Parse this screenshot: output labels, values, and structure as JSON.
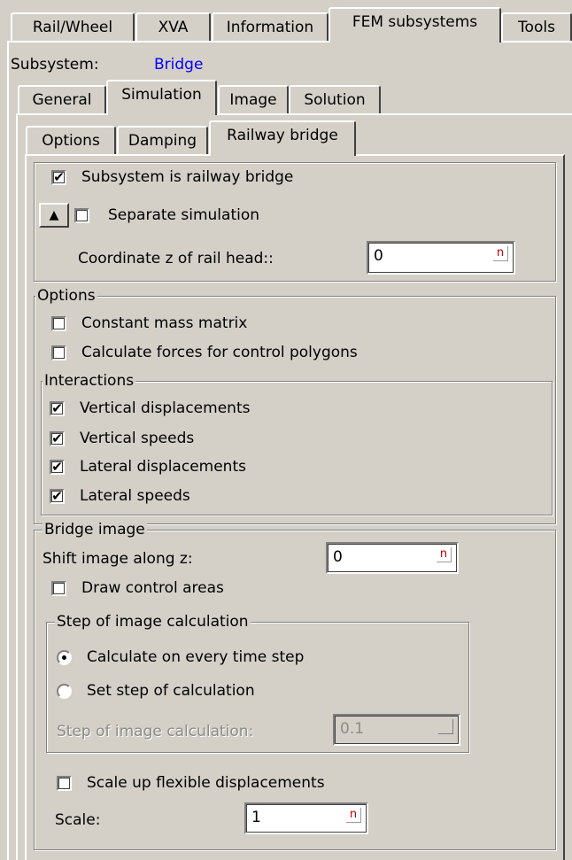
{
  "top_tabs": [
    "Rail/Wheel",
    "XVA",
    "Information",
    "FEM subsystems",
    "Tools"
  ],
  "active_top_tab": "FEM subsystems",
  "subsystem": {
    "label": "Subsystem:",
    "value": "Bridge",
    "value_color": "#0000ff"
  },
  "sub_tabs": [
    "General",
    "Simulation",
    "Image",
    "Solution"
  ],
  "active_sub_tab": "Simulation",
  "inner_tabs": [
    "Options",
    "Damping",
    "Railway bridge"
  ],
  "active_inner_tab": "Railway bridge",
  "railway": {
    "is_railway_bridge": {
      "label": "Subsystem is railway bridge",
      "checked": true
    },
    "separate_simulation": {
      "label": "Separate simulation",
      "checked": false
    },
    "up_icon": "triangle-up-icon",
    "rail_head": {
      "label": "Coordinate z of rail head::",
      "value": "0",
      "unit_icon": "n"
    }
  },
  "options": {
    "title": "Options",
    "constant_mass": {
      "label": "Constant mass matrix",
      "checked": false
    },
    "calc_forces": {
      "label": "Calculate forces for control polygons",
      "checked": false
    }
  },
  "interactions": {
    "title": "Interactions",
    "items": [
      {
        "label": "Vertical displacements",
        "checked": true
      },
      {
        "label": "Vertical speeds",
        "checked": true
      },
      {
        "label": "Lateral displacements",
        "checked": true
      },
      {
        "label": "Lateral speeds",
        "checked": true
      }
    ]
  },
  "bridge_image": {
    "title": "Bridge image",
    "shift": {
      "label": "Shift image along z:",
      "value": "0",
      "unit_icon": "n"
    },
    "draw_control": {
      "label": "Draw control areas",
      "checked": false
    },
    "step_group": {
      "title": "Step of image calculation",
      "every_step": {
        "label": "Calculate on every time step",
        "selected": true
      },
      "set_step": {
        "label": "Set step of calculation",
        "selected": false
      },
      "step_field": {
        "label": "Step of image calculation:",
        "value": "0.1"
      }
    },
    "scale_up": {
      "label": "Scale up flexible displacements",
      "checked": false
    },
    "scale": {
      "label": "Scale:",
      "value": "1",
      "unit_icon": "n"
    }
  }
}
